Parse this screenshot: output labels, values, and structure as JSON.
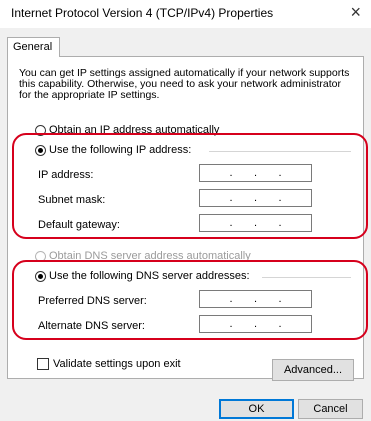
{
  "window": {
    "title": "Internet Protocol Version 4 (TCP/IPv4) Properties",
    "close_glyph": "×"
  },
  "tabs": [
    {
      "label": "General",
      "selected": true
    }
  ],
  "description": "You can get IP settings assigned automatically if your network supports this capability. Otherwise, you need to ask your network administrator for the appropriate IP settings.",
  "ip_section": {
    "auto_label": "Obtain an IP address automatically",
    "manual_label": "Use the following IP address:",
    "selected": "manual",
    "fields": [
      {
        "label": "IP address:",
        "value": ". . ."
      },
      {
        "label": "Subnet mask:",
        "value": ". . ."
      },
      {
        "label": "Default gateway:",
        "value": ". . ."
      }
    ]
  },
  "dns_section": {
    "auto_label": "Obtain DNS server address automatically",
    "manual_label": "Use the following DNS server addresses:",
    "selected": "manual",
    "fields": [
      {
        "label": "Preferred DNS server:",
        "value": ". . ."
      },
      {
        "label": "Alternate DNS server:",
        "value": ". . ."
      }
    ]
  },
  "validate": {
    "label": "Validate settings upon exit",
    "checked": false
  },
  "buttons": {
    "advanced": "Advanced...",
    "ok": "OK",
    "cancel": "Cancel"
  },
  "colors": {
    "highlight": "#d6001c",
    "dialog_bg": "#f0f0f0",
    "panel_bg": "#ffffff",
    "default_button_border": "#0078d7"
  }
}
